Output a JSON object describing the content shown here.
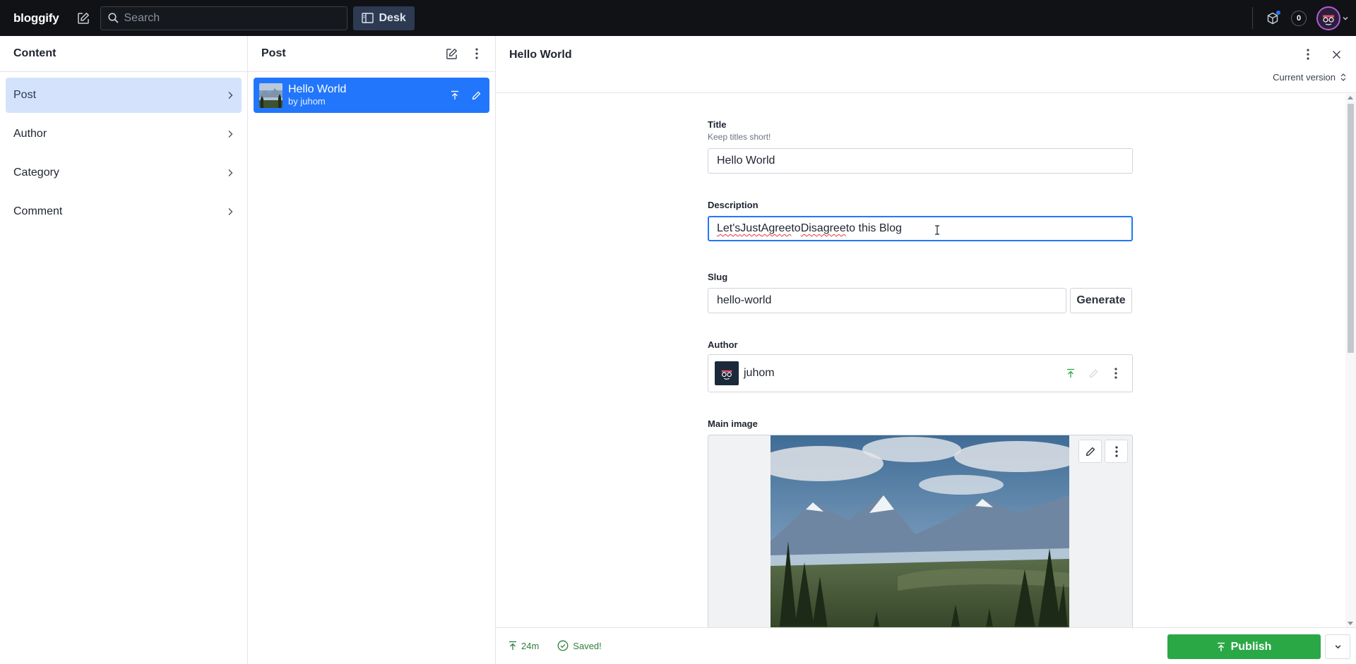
{
  "app": {
    "logo": "bloggify",
    "search_placeholder": "Search",
    "desk_label": "Desk",
    "notification_count": "0"
  },
  "content_pane": {
    "title": "Content",
    "items": [
      {
        "label": "Post"
      },
      {
        "label": "Author"
      },
      {
        "label": "Category"
      },
      {
        "label": "Comment"
      }
    ]
  },
  "post_pane": {
    "title": "Post",
    "documents": [
      {
        "title": "Hello World",
        "subtitle": "by juhom"
      }
    ]
  },
  "document": {
    "header_title": "Hello World",
    "version_label": "Current version",
    "fields": {
      "title": {
        "label": "Title",
        "description": "Keep titles short!",
        "value": "Hello World"
      },
      "description": {
        "label": "Description",
        "value_parts": [
          "Let's",
          " ",
          "Just",
          " ",
          "Agree",
          " to ",
          "Disagree",
          " to this Blog"
        ]
      },
      "slug": {
        "label": "Slug",
        "value": "hello-world",
        "generate_label": "Generate"
      },
      "author": {
        "label": "Author",
        "value": "juhom"
      },
      "main_image": {
        "label": "Main image"
      }
    },
    "footer": {
      "published_ago": "24m",
      "saved_status": "Saved!",
      "publish_label": "Publish"
    }
  },
  "colors": {
    "topbar": "#101216",
    "accent_blue": "#2276fc",
    "active_nav": "#d4e3fb",
    "publish_green": "#2aa845",
    "status_green": "#2f7d3e"
  },
  "icons": [
    "compose-icon",
    "search-icon",
    "desk-icon",
    "package-icon",
    "chevron-down-icon",
    "chevron-right-icon",
    "edit-icon",
    "more-vertical-icon",
    "close-icon",
    "up-down-icon",
    "publish-arrow-icon",
    "check-circle-icon",
    "pencil-icon"
  ]
}
